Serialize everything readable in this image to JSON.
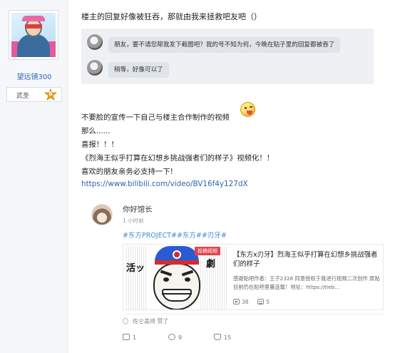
{
  "author": {
    "username": "望远镜300",
    "level_name": "武圣",
    "level_number": "6",
    "level_badge_color": "#e8a21c",
    "avatar_icon": "user-avatar-image"
  },
  "post": {
    "intro": "楼主的回复好像被狂吞，那就由我来拯救吧友吧（）",
    "quote": {
      "messages": [
        "朋友，要不请您帮我发下截图吧？我的号不知为何，今晚在贴子里的回复都被吞了",
        "稍等，好像可以了"
      ]
    },
    "lines": [
      "不要脸的宣传一下自己与楼主合作制作的视频",
      "那么......",
      "喜报！！！",
      "《烈海王似乎打算在幻想乡挑战强者们的样子》视频化！！",
      "喜欢的朋友亲务必支持一下!"
    ],
    "emoji_icon": "tongue-out-emoji-icon",
    "link": "https://www.bilibili.com/video/BV16f4y127dX"
  },
  "repost": {
    "name": "你好馆长",
    "time": "1 小时前",
    "tags": "#东方PROJECT##东方##刃牙#",
    "video": {
      "badge": "投稿视频",
      "title": "【东方x刃牙】烈海王似乎打算在幻想乡挑战强者们的样子",
      "description": "感谢贴吧作者：王子2326 同意授权于我进行视频二次创作 原贴目前仍在贴吧里量连载！地址：https://tieb...",
      "plays": "38",
      "danmaku": "5",
      "thumb_left_text": "活ッ",
      "thumb_right_text": "劇",
      "hat_color": "#2b5bd1",
      "band_color": "#d52c2c"
    },
    "liked_by": "佐仑盖绮 赞了",
    "actions": {
      "share": "1",
      "comment": "9",
      "like": "15"
    }
  },
  "colors": {
    "link": "#2d64b3",
    "tag": "#3e8ed6",
    "sidebar_bg": "#f6f7fb",
    "quote_bg": "#eef0f4"
  }
}
